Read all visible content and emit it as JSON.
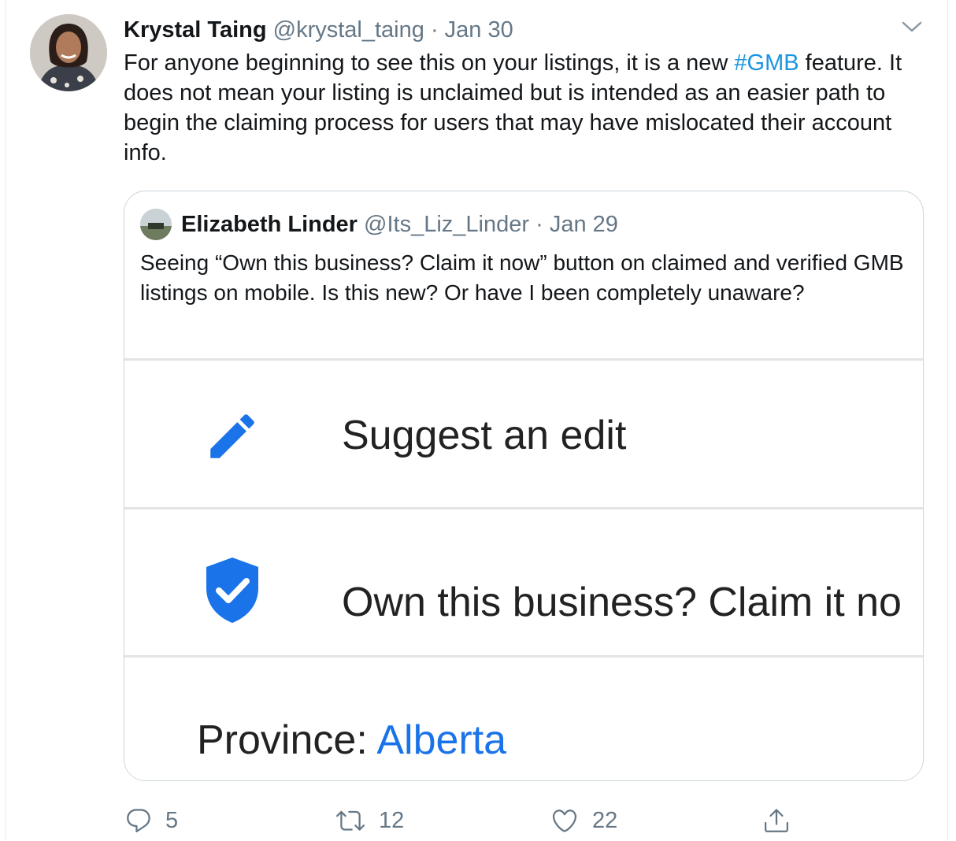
{
  "tweet": {
    "author_name": "Krystal Taing",
    "author_handle": "@krystal_taing",
    "separator": "·",
    "date": "Jan 30",
    "text_part1": "For anyone beginning to see this on your listings, it is a new ",
    "hashtag": "#GMB",
    "text_part2": " feature. It does not mean your listing is unclaimed but is intended as an easier path to begin the claiming process for users that may have mislocated their account info."
  },
  "quoted_tweet": {
    "author_name": "Elizabeth Linder",
    "author_handle": "@Its_Liz_Linder",
    "separator": "·",
    "date": "Jan 29",
    "text": "Seeing “Own this business? Claim it now” button on claimed and verified GMB listings on mobile. Is this new? Or have I been completely unaware?",
    "screenshot": {
      "suggest_edit_label": "Suggest an edit",
      "claim_label": "Own this business? Claim it no",
      "province_label": "Province:",
      "province_value": "Alberta"
    }
  },
  "actions": {
    "reply_count": "5",
    "retweet_count": "12",
    "like_count": "22"
  },
  "colors": {
    "accent": "#1b95e0",
    "secondary_text": "#657786",
    "google_blue": "#1a73e8"
  },
  "icons": [
    "chevron-down-icon",
    "pencil-icon",
    "shield-check-icon",
    "reply-icon",
    "retweet-icon",
    "heart-icon",
    "share-icon"
  ]
}
